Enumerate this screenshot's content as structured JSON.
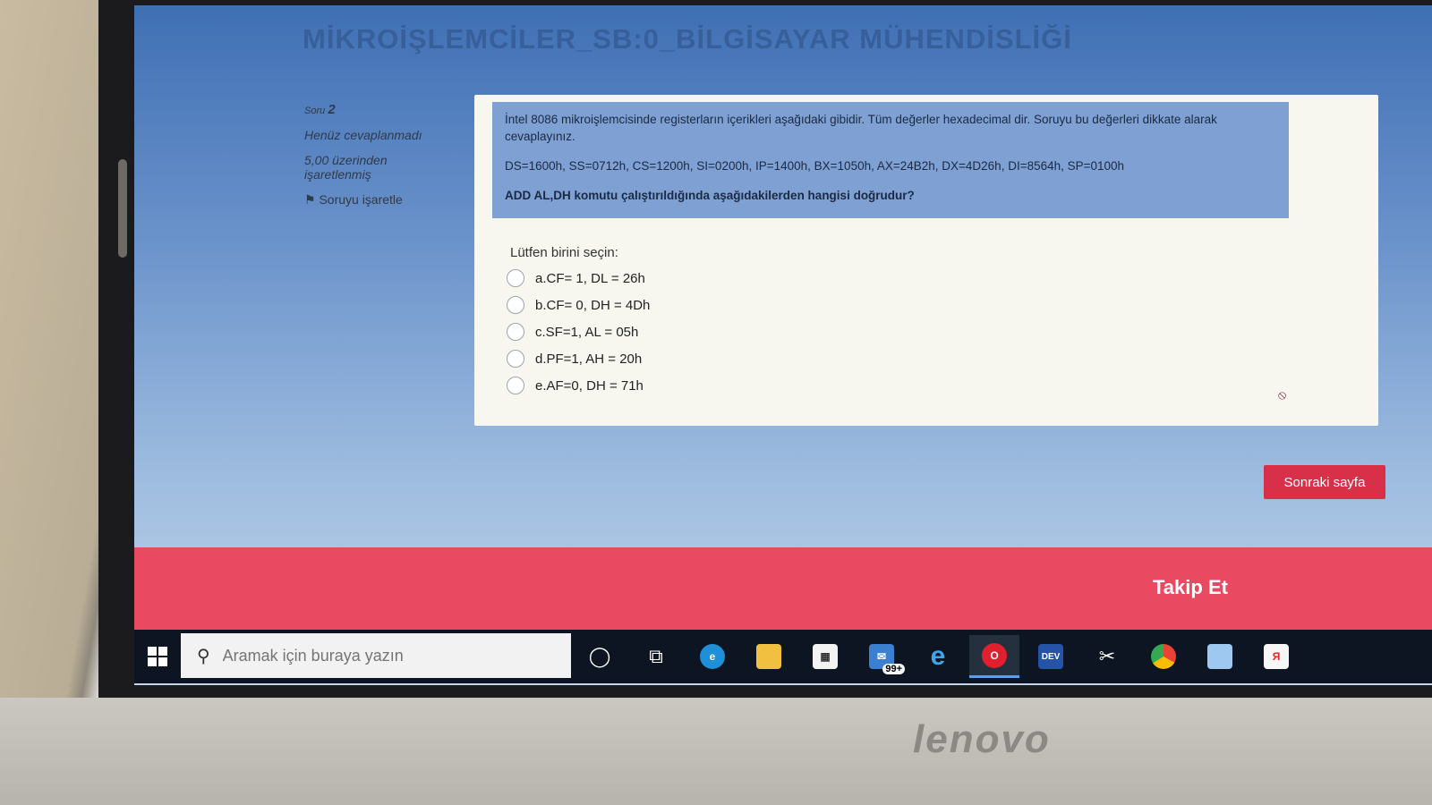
{
  "page": {
    "title": "MİKROİŞLEMCİLER_SB:0_BİLGİSAYAR MÜHENDİSLİĞİ"
  },
  "question_info": {
    "soru_prefix": "Soru",
    "number": "2",
    "status": "Henüz cevaplanmadı",
    "marks_line1": "5,00 üzerinden",
    "marks_line2": "işaretlenmiş",
    "flag_label": "Soruyu işaretle"
  },
  "question": {
    "intro": "İntel 8086 mikroişlemcisinde registerların içerikleri aşağıdaki gibidir. Tüm değerler hexadecimal dir. Soruyu bu değerleri dikkate alarak cevaplayınız.",
    "registers": "DS=1600h, SS=0712h, CS=1200h, SI=0200h, IP=1400h, BX=1050h, AX=24B2h, DX=4D26h, DI=8564h, SP=0100h",
    "ask": "ADD AL,DH komutu çalıştırıldığında aşağıdakilerden hangisi doğrudur?",
    "choose_label": "Lütfen birini seçin:",
    "options": [
      "a.CF= 1, DL = 26h",
      "b.CF= 0, DH = 4Dh",
      "c.SF=1, AL = 05h",
      "d.PF=1, AH = 20h",
      "e.AF=0, DH = 71h"
    ]
  },
  "next_button": "Sonraki sayfa",
  "footer": {
    "text": "Takip Et"
  },
  "taskbar": {
    "search_placeholder": "Aramak için buraya yazın",
    "mail_badge": "99+",
    "devcpp_label": "DEV"
  },
  "device": {
    "brand": "lenovo"
  },
  "colors": {
    "footer": "#ea4a61",
    "next_button": "#d9304a",
    "question_box": "#7ea0d2"
  }
}
